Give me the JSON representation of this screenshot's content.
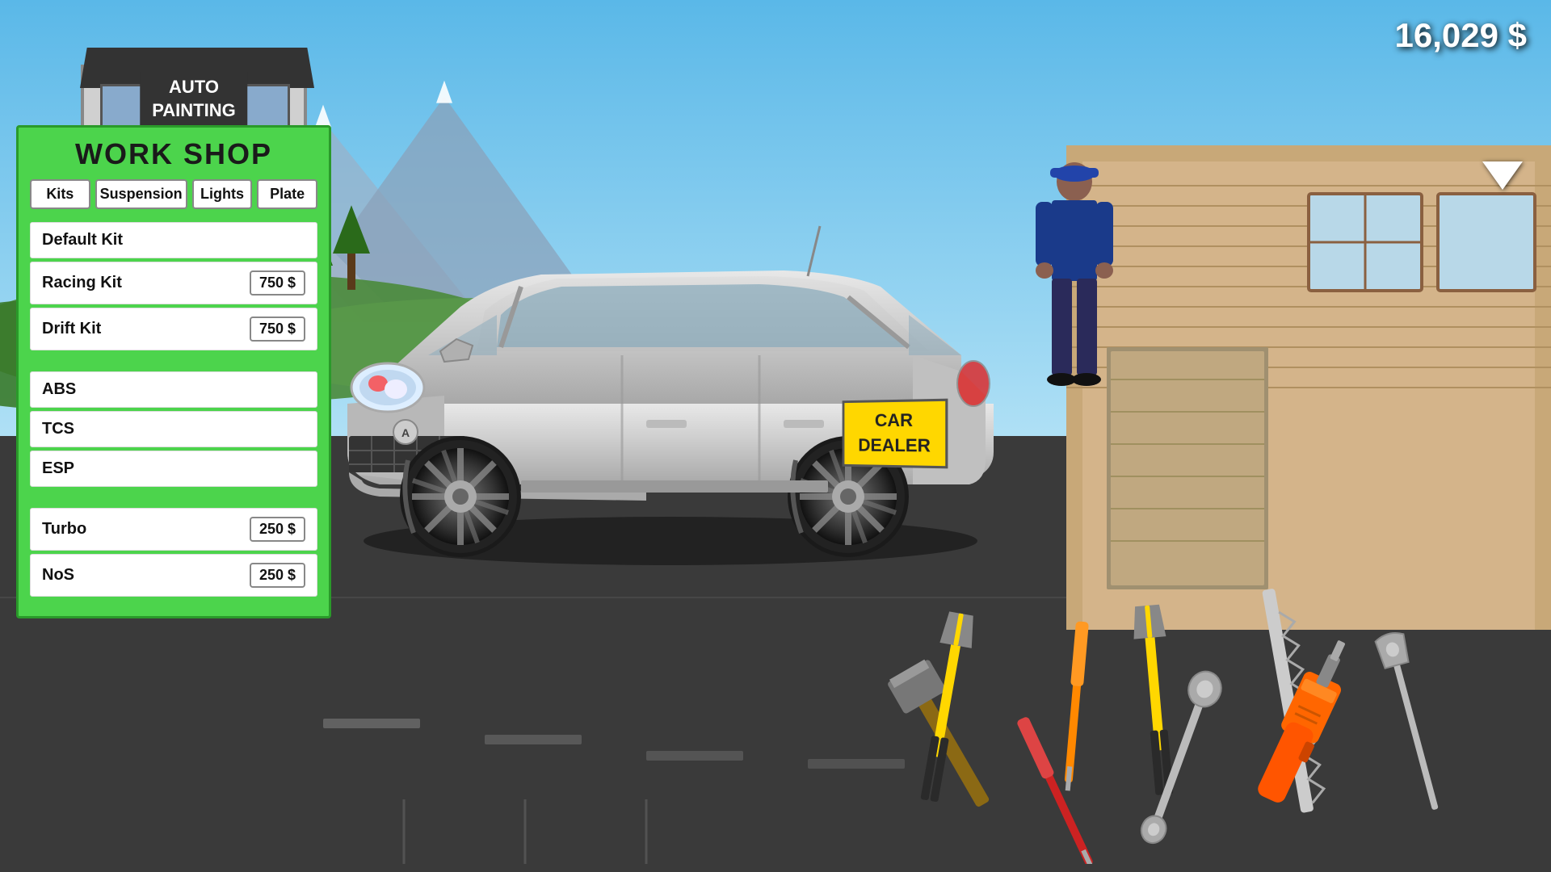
{
  "money": "16,029 $",
  "workshop": {
    "title": "WORK SHOP",
    "tabs": [
      {
        "label": "Kits",
        "id": "kits"
      },
      {
        "label": "Suspension",
        "id": "suspension"
      },
      {
        "label": "Lights",
        "id": "lights"
      },
      {
        "label": "Plate",
        "id": "plate"
      }
    ],
    "items": [
      {
        "name": "Default Kit",
        "price": null
      },
      {
        "name": "Racing Kit",
        "price": "750 $"
      },
      {
        "name": "Drift Kit",
        "price": "750 $"
      },
      {
        "name": "",
        "price": null,
        "spacer": true
      },
      {
        "name": "ABS",
        "price": null
      },
      {
        "name": "TCS",
        "price": null
      },
      {
        "name": "ESP",
        "price": null
      },
      {
        "name": "",
        "price": null,
        "spacer": true
      },
      {
        "name": "Turbo",
        "price": "250 $"
      },
      {
        "name": "NoS",
        "price": "250 $"
      }
    ]
  },
  "car_dealer_plate": {
    "line1": "CAR",
    "line2": "DEALER"
  },
  "auto_painting": {
    "line1": "AUTO",
    "line2": "PAINTING"
  }
}
